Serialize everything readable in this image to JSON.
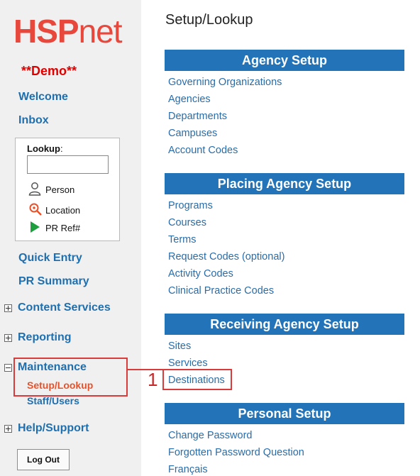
{
  "brand": {
    "logo_hsp": "HSP",
    "logo_net": "net",
    "demo_label": "**Demo**"
  },
  "nav": {
    "welcome": "Welcome",
    "inbox": "Inbox",
    "quick_entry": "Quick Entry",
    "pr_summary": "PR Summary"
  },
  "lookup": {
    "title": "Lookup",
    "colon": ":",
    "input_value": "",
    "options": [
      {
        "label": "Person",
        "icon": "person-icon"
      },
      {
        "label": "Location",
        "icon": "location-pin-icon"
      },
      {
        "label": "PR Ref#",
        "icon": "play-icon"
      }
    ]
  },
  "tree": {
    "content_services": "Content Services",
    "reporting": "Reporting",
    "maintenance": "Maintenance",
    "setup_lookup": "Setup/Lookup",
    "staff_users": "Staff/Users",
    "help_support": "Help/Support"
  },
  "logout_label": "Log Out",
  "page_title": "Setup/Lookup",
  "sections": [
    {
      "title": "Agency Setup",
      "links": [
        "Governing Organizations",
        "Agencies",
        "Departments",
        "Campuses",
        "Account Codes"
      ]
    },
    {
      "title": "Placing Agency Setup",
      "links": [
        "Programs",
        "Courses",
        "Terms",
        "Request Codes (optional)",
        "Activity Codes",
        "Clinical Practice Codes"
      ]
    },
    {
      "title": "Receiving Agency Setup",
      "links": [
        "Sites",
        "Services",
        "Destinations"
      ]
    },
    {
      "title": "Personal Setup",
      "links": [
        "Change Password",
        "Forgotten Password Question",
        "Français"
      ]
    }
  ],
  "annotation": {
    "number": "1"
  },
  "colors": {
    "accent_blue": "#2273b8",
    "link_blue": "#2a6ca8",
    "nav_blue": "#1f6fae",
    "logo_red": "#e8473c",
    "demo_red": "#e00000",
    "active_orange": "#e8522a",
    "callout_red": "#d93a3a"
  }
}
